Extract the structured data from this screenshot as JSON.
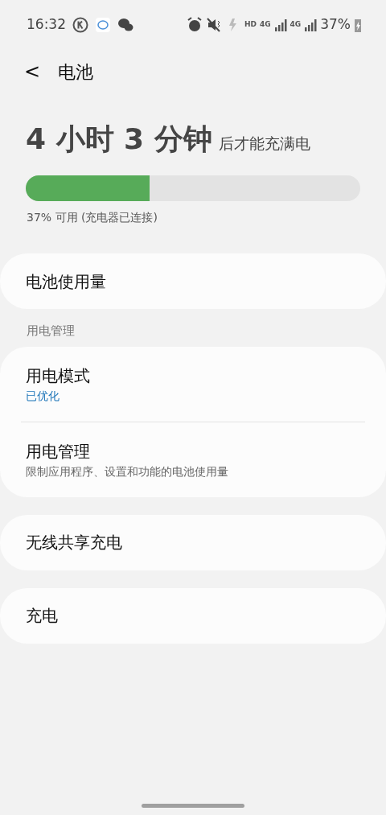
{
  "status_bar": {
    "time": "16:32",
    "network_labels": [
      "HD",
      "4G",
      "4G"
    ],
    "battery": "37%"
  },
  "header": {
    "back": "<",
    "title": "电池"
  },
  "charge": {
    "remaining": "4 小时 3 分钟",
    "suffix": "后才能充满电",
    "level": 0.37,
    "caption": "37% 可用 (充电器已连接)"
  },
  "groups": [
    {
      "items": [
        {
          "title": "电池使用量"
        }
      ]
    },
    {
      "section": "用电管理",
      "items": [
        {
          "title": "用电模式",
          "subtitle": "已优化",
          "kind": "accent"
        },
        {
          "title": "用电管理",
          "subtitle": "限制应用程序、设置和功能的电池使用量",
          "kind": "muted"
        }
      ]
    },
    {
      "items": [
        {
          "title": "无线共享充电"
        }
      ]
    },
    {
      "items": [
        {
          "title": "充电"
        }
      ]
    }
  ]
}
